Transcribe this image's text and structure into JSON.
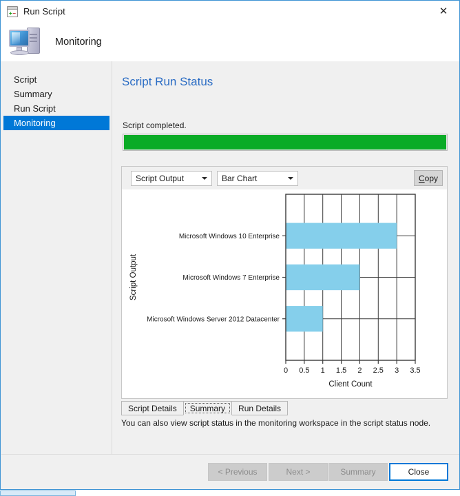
{
  "window": {
    "title": "Run Script",
    "title_icon": "script-window-icon",
    "close_icon": "close-icon",
    "header_title": "Monitoring",
    "header_icon": "computer-monitor-icon"
  },
  "sidebar": {
    "items": [
      {
        "label": "Script",
        "selected": false
      },
      {
        "label": "Summary",
        "selected": false
      },
      {
        "label": "Run Script",
        "selected": false
      },
      {
        "label": "Monitoring",
        "selected": true
      }
    ]
  },
  "main": {
    "page_title": "Script Run Status",
    "status_text": "Script completed.",
    "progress_percent": 100,
    "progress_color": "#0aab26",
    "hint_text": "You can also view script status in the monitoring workspace in the script status node."
  },
  "chart_toolbar": {
    "source_select": {
      "value": "Script Output",
      "options": [
        "Script Output"
      ]
    },
    "type_select": {
      "value": "Bar Chart",
      "options": [
        "Bar Chart"
      ]
    },
    "copy_button": {
      "accel": "C",
      "rest": "opy"
    }
  },
  "tabs": [
    {
      "label": "Script Details",
      "selected": false
    },
    {
      "label": "Summary",
      "selected": true
    },
    {
      "label": "Run Details",
      "selected": false
    }
  ],
  "footer": {
    "previous": {
      "label": "< Previous",
      "enabled": false
    },
    "next": {
      "label": "Next >",
      "enabled": false
    },
    "summary": {
      "label": "Summary",
      "enabled": false
    },
    "close": {
      "label": "Close",
      "enabled": true
    }
  },
  "chart_data": {
    "type": "bar",
    "orientation": "horizontal",
    "title": "",
    "xlabel": "Client Count",
    "ylabel": "Script Output",
    "categories": [
      "Microsoft Windows 10 Enterprise",
      "Microsoft Windows 7 Enterprise",
      "Microsoft Windows Server 2012 Datacenter"
    ],
    "values": [
      3,
      2,
      1
    ],
    "xlim": [
      0,
      3.5
    ],
    "xticks": [
      0,
      0.5,
      1,
      1.5,
      2,
      2.5,
      3,
      3.5
    ],
    "xtick_labels": [
      "0",
      "0.5",
      "1",
      "1.5",
      "2",
      "2.5",
      "3",
      "3.5"
    ],
    "grid": true,
    "bar_color": "#85cfeb",
    "axis_color": "#3a3a3a",
    "legend": null
  }
}
